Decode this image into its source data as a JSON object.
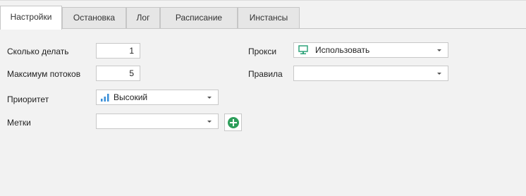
{
  "tabs": [
    {
      "label": "Настройки",
      "active": true
    },
    {
      "label": "Остановка",
      "active": false
    },
    {
      "label": "Лог",
      "active": false
    },
    {
      "label": "Расписание",
      "active": false
    },
    {
      "label": "Инстансы",
      "active": false
    }
  ],
  "settings": {
    "count_label": "Сколько делать",
    "count_value": "1",
    "threads_label": "Максимум потоков",
    "threads_value": "5",
    "priority_label": "Приоритет",
    "priority_value": "Высокий",
    "tags_label": "Метки",
    "tags_value": "",
    "proxy_label": "Прокси",
    "proxy_value": "Использовать",
    "rules_label": "Правила",
    "rules_value": ""
  },
  "icons": {
    "priority": "signal-bars-icon",
    "proxy": "monitor-icon",
    "add": "plus-circle-icon"
  },
  "colors": {
    "accent_blue": "#3a8fd8",
    "proxy_green": "#2fa37a",
    "add_green": "#2e9e5b"
  }
}
